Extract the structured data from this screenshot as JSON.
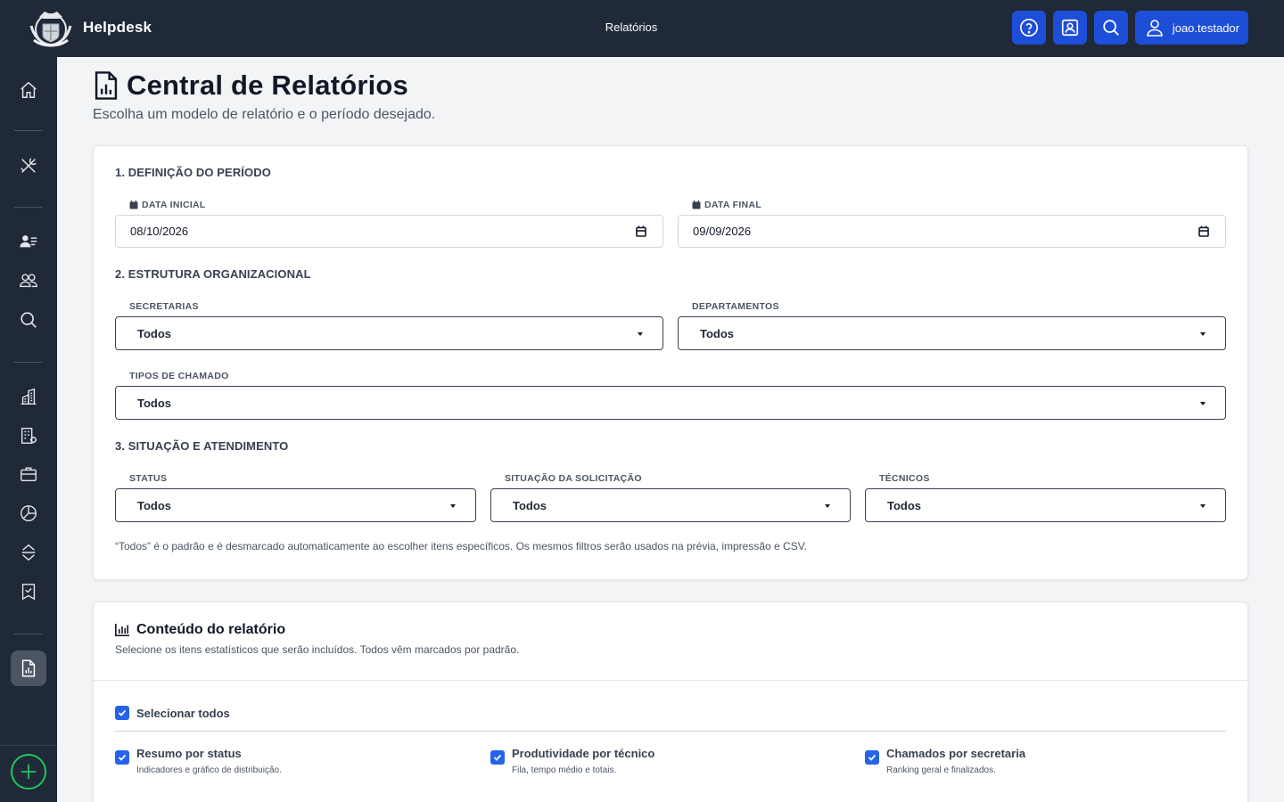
{
  "header": {
    "app_name": "Helpdesk",
    "page": "Relatórios",
    "user": "joao.testador",
    "icons": [
      "help-icon",
      "contact-card-icon",
      "search-icon",
      "user-icon"
    ]
  },
  "sidebar": {
    "items": [
      {
        "icon": "home-icon",
        "active": false
      },
      {
        "icon": "tools-icon",
        "active": false
      },
      {
        "icon": "user-list-icon",
        "active": false
      },
      {
        "icon": "users-icon",
        "active": false
      },
      {
        "icon": "search-icon",
        "active": false
      },
      {
        "icon": "building-icon",
        "active": false
      },
      {
        "icon": "office-icon",
        "active": false
      },
      {
        "icon": "briefcase-icon",
        "active": false
      },
      {
        "icon": "pie-chart-icon",
        "active": false
      },
      {
        "icon": "sort-icon",
        "active": false
      },
      {
        "icon": "bookmark-check-icon",
        "active": false
      },
      {
        "icon": "report-icon",
        "active": true
      }
    ],
    "add_icon": "plus-circle-icon"
  },
  "page": {
    "title": "Central de Relatórios",
    "subtitle": "Escolha um modelo de relatório e o período desejado."
  },
  "filters": {
    "section1": "1. DEFINIÇÃO DO PERÍODO",
    "start_label": "DATA INICIAL",
    "start_value": "08/10/2026",
    "end_label": "DATA FINAL",
    "end_value": "09/09/2026",
    "section2": "2. ESTRUTURA ORGANIZACIONAL",
    "secretarias_label": "SECRETARIAS",
    "secretarias_value": "Todos",
    "departamentos_label": "DEPARTAMENTOS",
    "departamentos_value": "Todos",
    "tipos_label": "TIPOS DE CHAMADO",
    "tipos_value": "Todos",
    "section3": "3. SITUAÇÃO E ATENDIMENTO",
    "status_label": "STATUS",
    "status_value": "Todos",
    "situacao_label": "SITUAÇÃO DA SOLICITAÇÃO",
    "situacao_value": "Todos",
    "tecnicos_label": "TÉCNICOS",
    "tecnicos_value": "Todos",
    "hint": "“Todos” é o padrão e é desmarcado automaticamente ao escolher itens específicos. Os mesmos filtros serão usados na prévia, impressão e CSV."
  },
  "content": {
    "title": "Conteúdo do relatório",
    "subtitle": "Selecione os itens estatísticos que serão incluídos. Todos vêm marcados por padrão.",
    "select_all": "Selecionar todos",
    "options": [
      {
        "title": "Resumo por status",
        "desc": "Indicadores e gráfico de distribuição.",
        "checked": true
      },
      {
        "title": "Produtividade por técnico",
        "desc": "Fila, tempo médio e totais.",
        "checked": true
      },
      {
        "title": "Chamados por secretaria",
        "desc": "Ranking geral e finalizados.",
        "checked": true
      }
    ]
  },
  "colors": {
    "topbar": "#1f2937",
    "accent": "#1d4ed8",
    "checkbox": "#2563eb",
    "add_button": "#22c55e"
  }
}
